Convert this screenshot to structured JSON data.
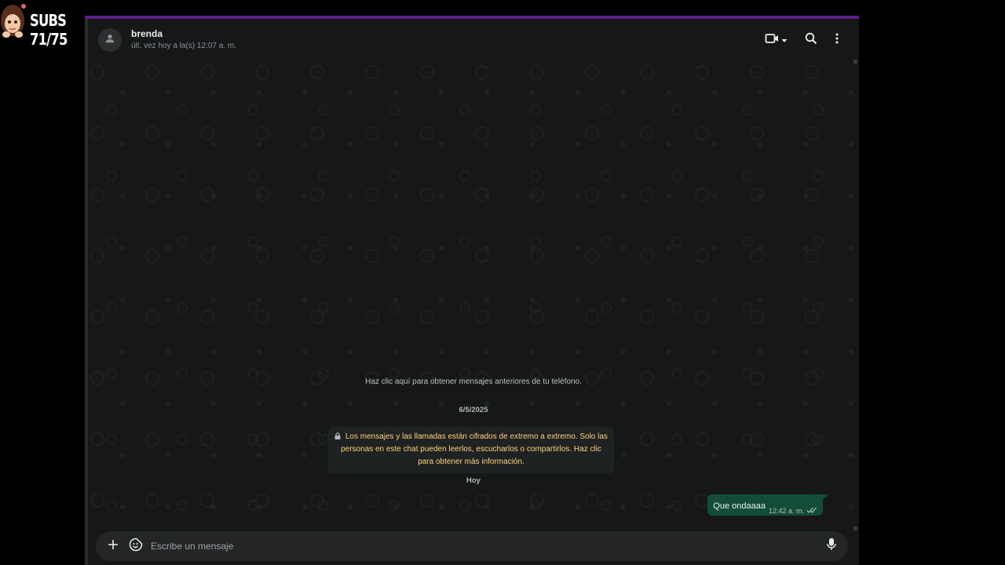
{
  "overlay": {
    "subs_label": "SUBS 71/75"
  },
  "chat_header": {
    "contact_name": "brenda",
    "last_seen": "últ. vez hoy a la(s) 12:07 a. m."
  },
  "icons": {
    "avatar": "default-person-icon",
    "video": "video-call-icon",
    "dropdown": "chevron-down-icon",
    "search": "search-icon",
    "menu": "more-vertical-icon",
    "lock": "lock-icon",
    "read_receipt": "double-check-icon",
    "attach": "plus-icon",
    "emoji": "sticker-icon",
    "mic": "mic-icon"
  },
  "conversation": {
    "load_older": "Haz clic aquí para obtener mensajes anteriores de tu teléfono.",
    "date_label": "6/5/2025",
    "encryption_notice": "Los mensajes y las llamadas están cifrados de extremo a extremo. Solo las personas en este chat pueden leerlos, escucharlos o compartirlos. Haz clic para obtener más información.",
    "today_label": "Hoy",
    "messages": [
      {
        "text": "Que ondaaaa",
        "time": "12:42 a. m.",
        "status": "read"
      }
    ]
  },
  "composer": {
    "placeholder": "Escribe un mensaje"
  },
  "colors": {
    "window_bg": "#161717",
    "outgoing_bubble": "#144d37",
    "encryption_text": "#ffd279",
    "accent_bar": "#5c1f8a"
  }
}
